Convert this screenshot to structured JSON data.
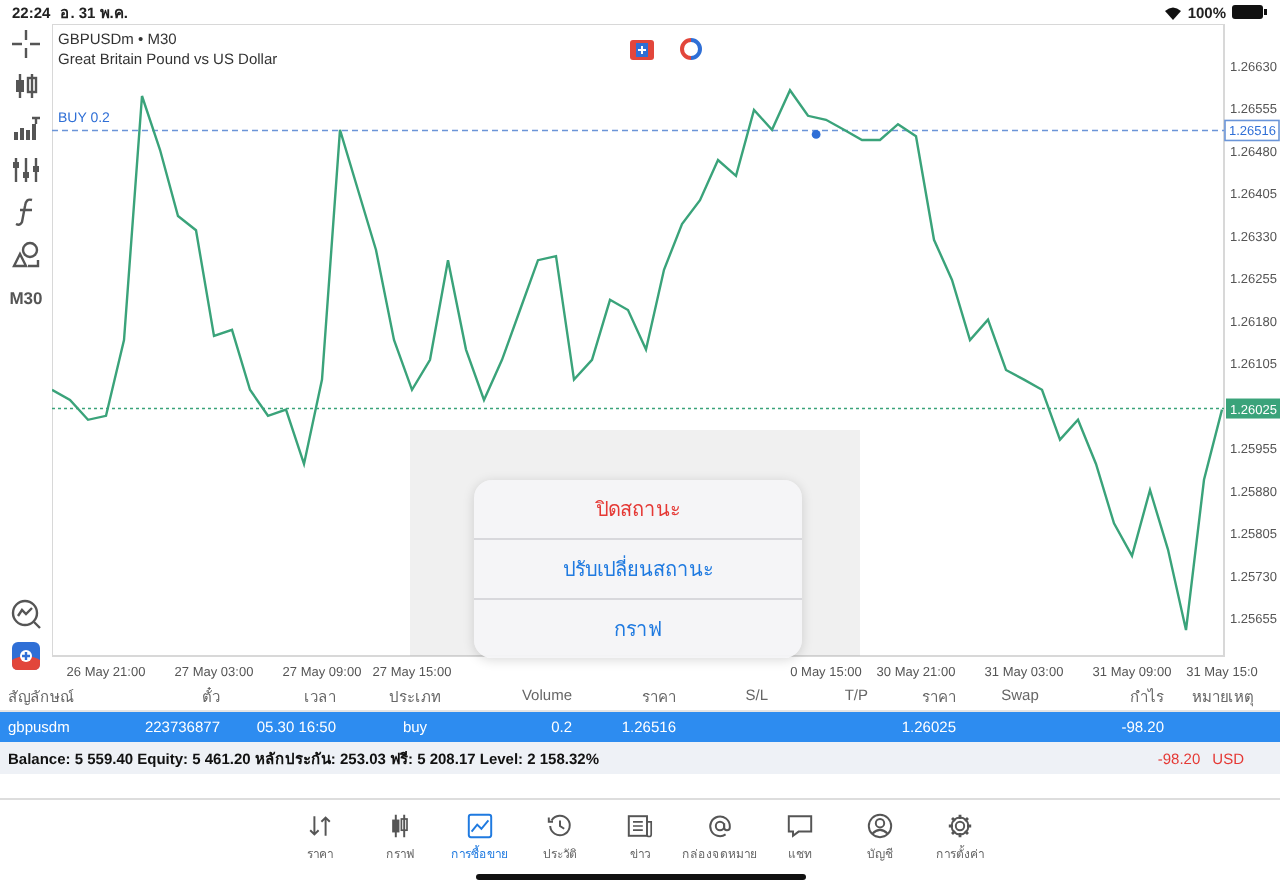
{
  "status_bar": {
    "time": "22:24",
    "date": "อ. 31 พ.ค.",
    "battery": "100%"
  },
  "chart": {
    "symbol": "GBPUSDm • M30",
    "description": "Great Britain Pound vs US Dollar",
    "timeframe": "M30",
    "buy_label": "BUY 0.2",
    "buy_price": "1.26516",
    "current_price": "1.26025",
    "chart_data": {
      "type": "line",
      "categories": [
        null,
        null,
        null,
        "26 May 21:00",
        null,
        null,
        null,
        null,
        null,
        "27 May 03:00",
        null,
        null,
        null,
        null,
        null,
        "27 May 09:00",
        null,
        null,
        null,
        null,
        "27 May 15:00",
        null,
        null,
        null,
        null,
        null,
        null,
        null,
        null,
        null,
        null,
        null,
        null,
        null,
        null,
        null,
        null,
        null,
        null,
        null,
        null,
        null,
        null,
        "0 May 15:00",
        null,
        null,
        null,
        null,
        "30 May 21:00",
        null,
        null,
        null,
        null,
        null,
        "31 May 03:00",
        null,
        null,
        null,
        null,
        null,
        "31 May 09:00",
        null,
        null,
        null,
        null,
        "31 May 15:0"
      ],
      "series": [
        {
          "color": "#3aa37a",
          "values": [
            1.26058,
            1.2604,
            1.26005,
            1.26012,
            1.26146,
            1.26577,
            1.26482,
            1.26365,
            1.2634,
            1.26153,
            1.26164,
            1.26058,
            1.26012,
            1.26023,
            1.25927,
            1.26076,
            1.26517,
            1.26411,
            1.26305,
            1.26146,
            1.26058,
            1.26111,
            1.26287,
            1.26129,
            1.2604,
            1.26111,
            1.26199,
            1.26287,
            1.26294,
            1.26076,
            1.26111,
            1.26217,
            1.26199,
            1.26129,
            1.2627,
            1.26351,
            1.26393,
            1.26464,
            1.26436,
            1.26552,
            1.26517,
            1.26587,
            1.26542,
            1.26535,
            1.26517,
            1.26499,
            1.26499,
            1.26527,
            1.26506,
            1.26323,
            1.26252,
            1.26146,
            1.26182,
            1.26093,
            1.26076,
            1.26058,
            1.2597,
            1.26005,
            1.25927,
            1.25822,
            1.25765,
            1.25881,
            1.25776,
            1.25634,
            1.25899,
            1.26023
          ]
        }
      ],
      "ylim": [
        1.25588,
        1.26704
      ],
      "yticks": [
        {
          "value": 1.2663,
          "label": "1.26630"
        },
        {
          "value": 1.26555,
          "label": "1.26555"
        },
        {
          "value": 1.2648,
          "label": "1.26480"
        },
        {
          "value": 1.26405,
          "label": "1.26405"
        },
        {
          "value": 1.2633,
          "label": "1.26330"
        },
        {
          "value": 1.26255,
          "label": "1.26255"
        },
        {
          "value": 1.2618,
          "label": "1.26180"
        },
        {
          "value": 1.26105,
          "label": "1.26105"
        },
        {
          "value": 1.25955,
          "label": "1.25955"
        },
        {
          "value": 1.2588,
          "label": "1.25880"
        },
        {
          "value": 1.25805,
          "label": "1.25805"
        },
        {
          "value": 1.2573,
          "label": "1.25730"
        },
        {
          "value": 1.25655,
          "label": "1.25655"
        }
      ],
      "ref_lines": [
        {
          "axis": "y",
          "value": 1.26516,
          "color": "#6b95d8"
        },
        {
          "axis": "y",
          "value": 1.26025,
          "color": "#3aa37a"
        }
      ]
    }
  },
  "popup": {
    "actions": [
      {
        "label": "ปิดสถานะ",
        "kind": "destructive"
      },
      {
        "label": "ปรับเปลี่ยนสถานะ",
        "kind": "default"
      },
      {
        "label": "กราฟ",
        "kind": "default"
      }
    ]
  },
  "positions": {
    "columns": [
      "สัญลักษณ์",
      "ตั๋ว",
      "เวลา",
      "ประเภท",
      "Volume",
      "ราคา",
      "S/L",
      "T/P",
      "ราคา",
      "Swap",
      "กำไร",
      "หมายเหตุ"
    ],
    "rows": [
      {
        "selected": true,
        "cells": [
          "gbpusdm",
          "223736877",
          "05.30 16:50",
          "buy",
          "0.2",
          "1.26516",
          "",
          "",
          "1.26025",
          "",
          "-98.20"
        ]
      }
    ]
  },
  "summary": {
    "text": "Balance: 5 559.40 Equity: 5 461.20 หลักประกัน: 253.03 ฟรี: 5 208.17 Level: 2 158.32%",
    "profit": "-98.20",
    "currency": "USD"
  },
  "tab_bar": {
    "items": [
      {
        "label": "ราคา",
        "kind": "quotes",
        "selected": false
      },
      {
        "label": "กราฟ",
        "kind": "chart",
        "selected": false
      },
      {
        "label": "การซื้อขาย",
        "kind": "trade",
        "selected": true
      },
      {
        "label": "ประวัติ",
        "kind": "history",
        "selected": false
      },
      {
        "label": "ข่าว",
        "kind": "news",
        "selected": false
      },
      {
        "label": "กล่องจดหมาย",
        "kind": "mail",
        "selected": false
      },
      {
        "label": "แชท",
        "kind": "chat",
        "selected": false
      },
      {
        "label": "บัญชี",
        "kind": "account",
        "selected": false
      },
      {
        "label": "การตั้งค่า",
        "kind": "settings",
        "selected": false
      }
    ]
  }
}
